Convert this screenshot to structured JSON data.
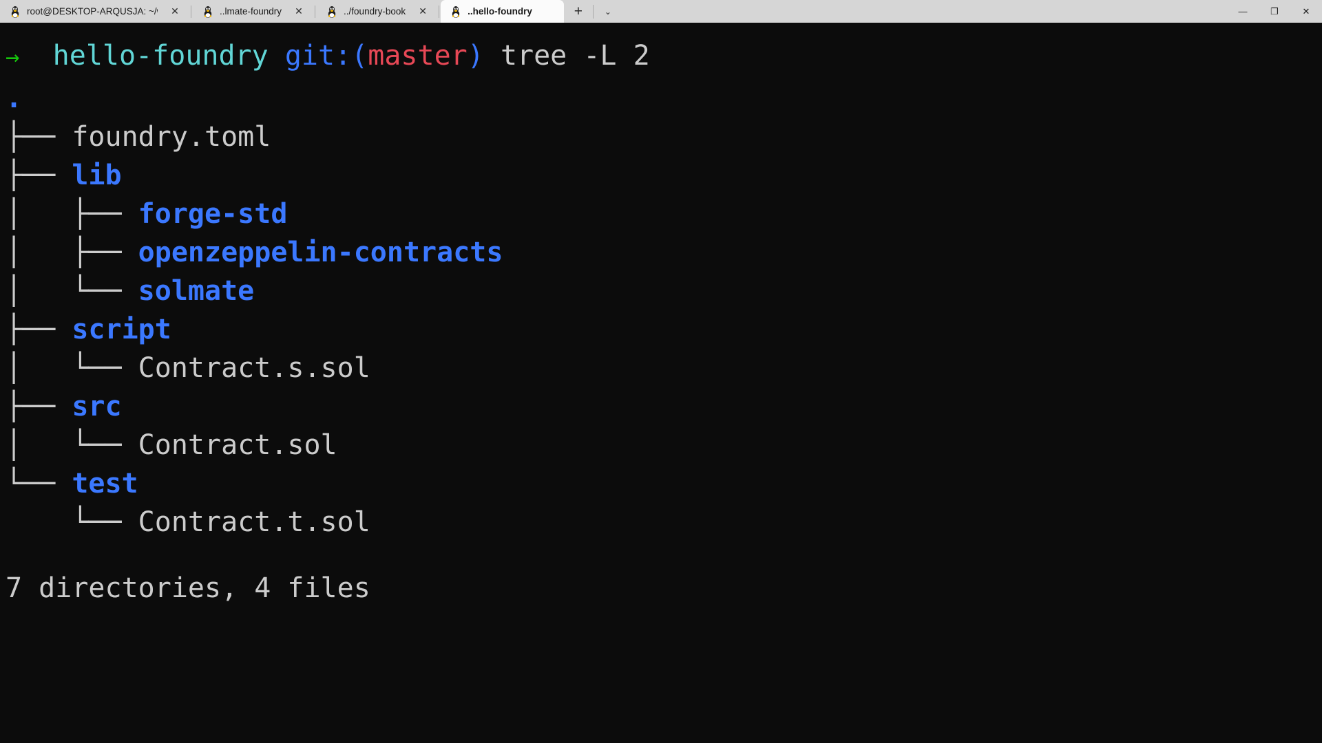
{
  "window": {
    "tabs": [
      {
        "label": "root@DESKTOP-ARQUSJA: ~/w",
        "icon": "linux-tux-icon",
        "active": false,
        "close_label": "✕"
      },
      {
        "label": "..lmate-foundry",
        "icon": "linux-tux-icon",
        "active": false,
        "close_label": "✕"
      },
      {
        "label": "../foundry-book",
        "icon": "linux-tux-icon",
        "active": false,
        "close_label": "✕"
      },
      {
        "label": "..hello-foundry",
        "icon": "linux-tux-icon",
        "active": true,
        "close_label": "✕"
      }
    ],
    "new_tab_label": "+",
    "dropdown_label": "⌄",
    "controls": {
      "minimize": "—",
      "maximize": "❐",
      "close": "✕"
    }
  },
  "terminal": {
    "prompt": {
      "arrow": "→",
      "directory": "hello-foundry",
      "git_prefix": "git:(",
      "git_branch": "master",
      "git_suffix": ")",
      "command": "tree -L 2"
    },
    "tree": {
      "root": ".",
      "rows": [
        {
          "branch": "├── ",
          "indent": "",
          "name": "foundry.toml",
          "kind": "file"
        },
        {
          "branch": "├── ",
          "indent": "",
          "name": "lib",
          "kind": "dir"
        },
        {
          "branch": "├── ",
          "indent": "│   ",
          "name": "forge-std",
          "kind": "dir"
        },
        {
          "branch": "├── ",
          "indent": "│   ",
          "name": "openzeppelin-contracts",
          "kind": "dir"
        },
        {
          "branch": "└── ",
          "indent": "│   ",
          "name": "solmate",
          "kind": "dir"
        },
        {
          "branch": "├── ",
          "indent": "",
          "name": "script",
          "kind": "dir"
        },
        {
          "branch": "└── ",
          "indent": "│   ",
          "name": "Contract.s.sol",
          "kind": "file"
        },
        {
          "branch": "├── ",
          "indent": "",
          "name": "src",
          "kind": "dir"
        },
        {
          "branch": "└── ",
          "indent": "│   ",
          "name": "Contract.sol",
          "kind": "file"
        },
        {
          "branch": "└── ",
          "indent": "",
          "name": "test",
          "kind": "dir"
        },
        {
          "branch": "└── ",
          "indent": "    ",
          "name": "Contract.t.sol",
          "kind": "file"
        }
      ]
    },
    "summary": "7 directories, 4 files"
  },
  "colors": {
    "background": "#0c0c0c",
    "foreground": "#cccccc",
    "directory": "#3b78ff",
    "branch_red": "#e74856",
    "prompt_green": "#16c60c",
    "prompt_cyan": "#61d6d6",
    "titlebar": "#d6d6d6",
    "active_tab": "#fbfbfb"
  }
}
